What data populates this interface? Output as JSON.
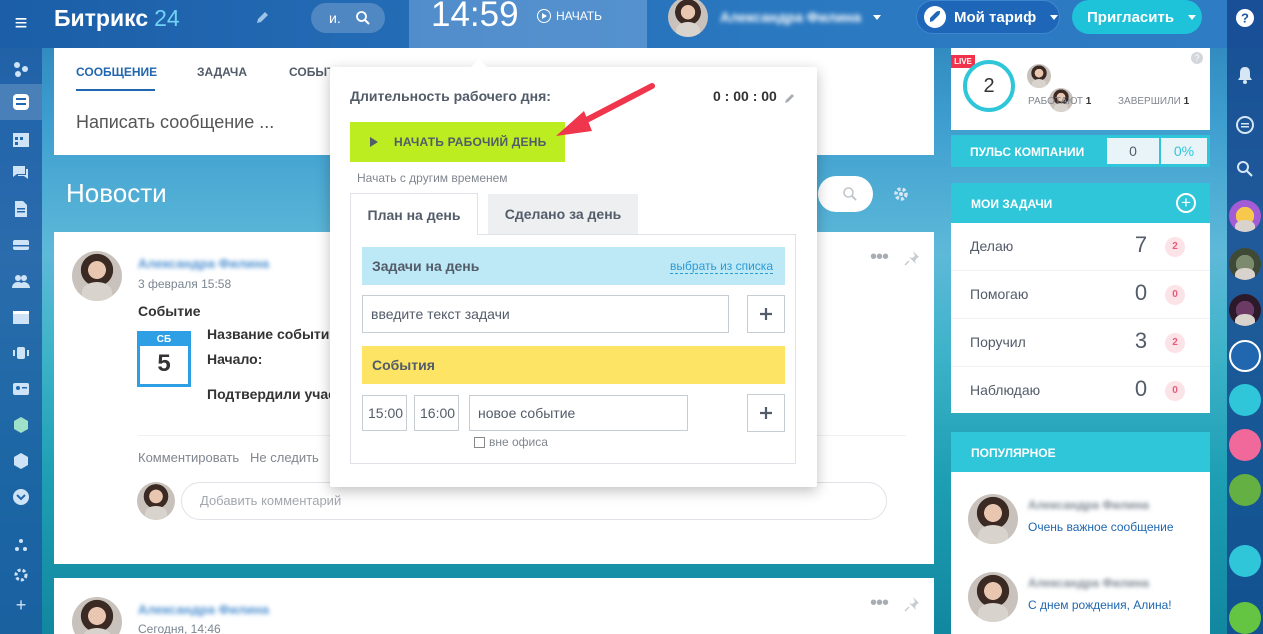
{
  "header": {
    "logo_main": "Битрикс",
    "logo_num": "24",
    "search_text": "и.",
    "clock": "14:59",
    "clock_start": "НАЧАТЬ",
    "user_name": "Александра Филина",
    "tariff": "Мой тариф",
    "invite": "Пригласить"
  },
  "composer": {
    "tabs": [
      "СООБЩЕНИЕ",
      "ЗАДАЧА",
      "СОБЫТ"
    ],
    "placeholder": "Написать сообщение ..."
  },
  "news": {
    "title": "Новости"
  },
  "post1": {
    "author": "Александра Филина",
    "date": "3 февраля 15:58",
    "type": "Событие",
    "cal_dow": "СБ",
    "cal_day": "5",
    "field_name": "Название событи",
    "field_start": "Начало:",
    "field_confirmed": "Подтвердили учас",
    "action_comment": "Комментировать",
    "action_unfollow": "Не следить",
    "comment_placeholder": "Добавить комментарий"
  },
  "post2": {
    "author": "Александра Филина",
    "date": "Сегодня, 14:46"
  },
  "workday": {
    "title": "Длительность рабочего дня:",
    "timer": "0 : 00 : 00",
    "start_button": "НАЧАТЬ РАБОЧИЙ ДЕНЬ",
    "other_time": "Начать с другим временем",
    "tab_plan": "План на день",
    "tab_done": "Сделано за день",
    "tasks_header": "Задачи на день",
    "tasks_link": "выбрать из списка",
    "task_placeholder": "введите текст задачи",
    "events_header": "События",
    "event_from": "15:00",
    "event_to": "16:00",
    "event_placeholder": "новое событие",
    "outside_office": "вне офиса"
  },
  "live": {
    "badge": "LIVE",
    "count": "2",
    "working_label": "РАБОТАЮТ",
    "working_count": "1",
    "finished_label": "ЗАВЕРШИЛИ",
    "finished_count": "1"
  },
  "pulse": {
    "title": "ПУЛЬС КОМПАНИИ",
    "value": "0",
    "percent": "0%"
  },
  "my_tasks": {
    "title": "МОИ ЗАДАЧИ",
    "rows": [
      {
        "label": "Делаю",
        "count": "7",
        "badge": "2"
      },
      {
        "label": "Помогаю",
        "count": "0",
        "badge": "0"
      },
      {
        "label": "Поручил",
        "count": "3",
        "badge": "2"
      },
      {
        "label": "Наблюдаю",
        "count": "0",
        "badge": "0"
      }
    ]
  },
  "popular": {
    "title": "ПОПУЛЯРНОЕ",
    "items": [
      {
        "name": "Александра Филина",
        "text": "Очень важное сообщение"
      },
      {
        "name": "Александра Филина",
        "text": "С днем рождения, Алина!"
      }
    ]
  },
  "colors": {
    "accent": "#2067b0",
    "cyan": "#2fc6da",
    "start_green": "#bbed21",
    "red_arrow": "#f0364c"
  }
}
